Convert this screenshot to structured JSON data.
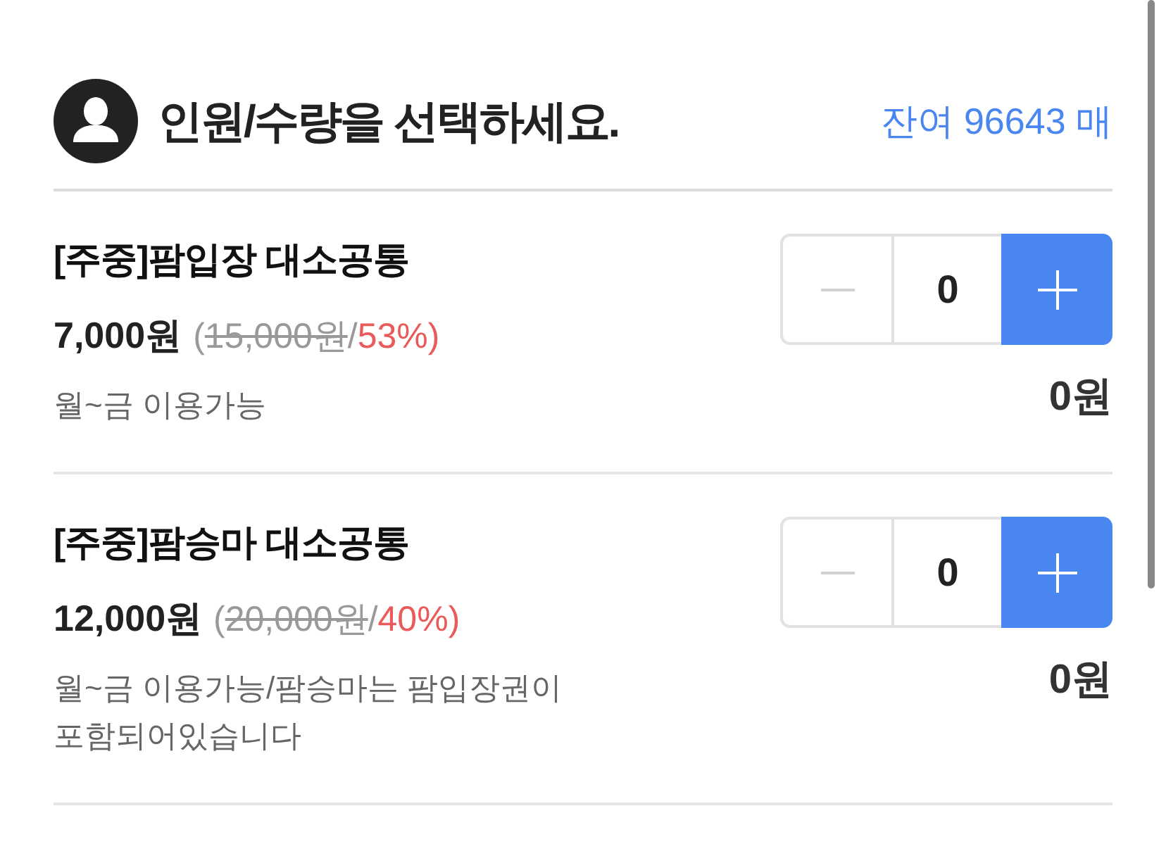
{
  "header": {
    "title": "인원/수량을 선택하세요.",
    "remaining": "잔여 96643 매"
  },
  "items": [
    {
      "name": "[주중]팜입장 대소공통",
      "price": "7,000원",
      "price_note": [
        {
          "kind": "plain",
          "text": "("
        },
        {
          "kind": "struck",
          "text": "15,000원"
        },
        {
          "kind": "plain",
          "text": "/"
        },
        {
          "kind": "discount",
          "text": "53%)"
        }
      ],
      "description": "월~금 이용가능",
      "quantity": "0",
      "decrease_disabled": true,
      "total": "0원"
    },
    {
      "name": "[주중]팜승마 대소공통",
      "price": "12,000원",
      "price_note": [
        {
          "kind": "plain",
          "text": "("
        },
        {
          "kind": "struck",
          "text": "20,000원"
        },
        {
          "kind": "plain",
          "text": "/"
        },
        {
          "kind": "discount",
          "text": "40%)"
        }
      ],
      "description": "월~금 이용가능/팜승마는 팜입장권이 포함되어있습니다",
      "quantity": "0",
      "decrease_disabled": true,
      "total": "0원"
    }
  ]
}
